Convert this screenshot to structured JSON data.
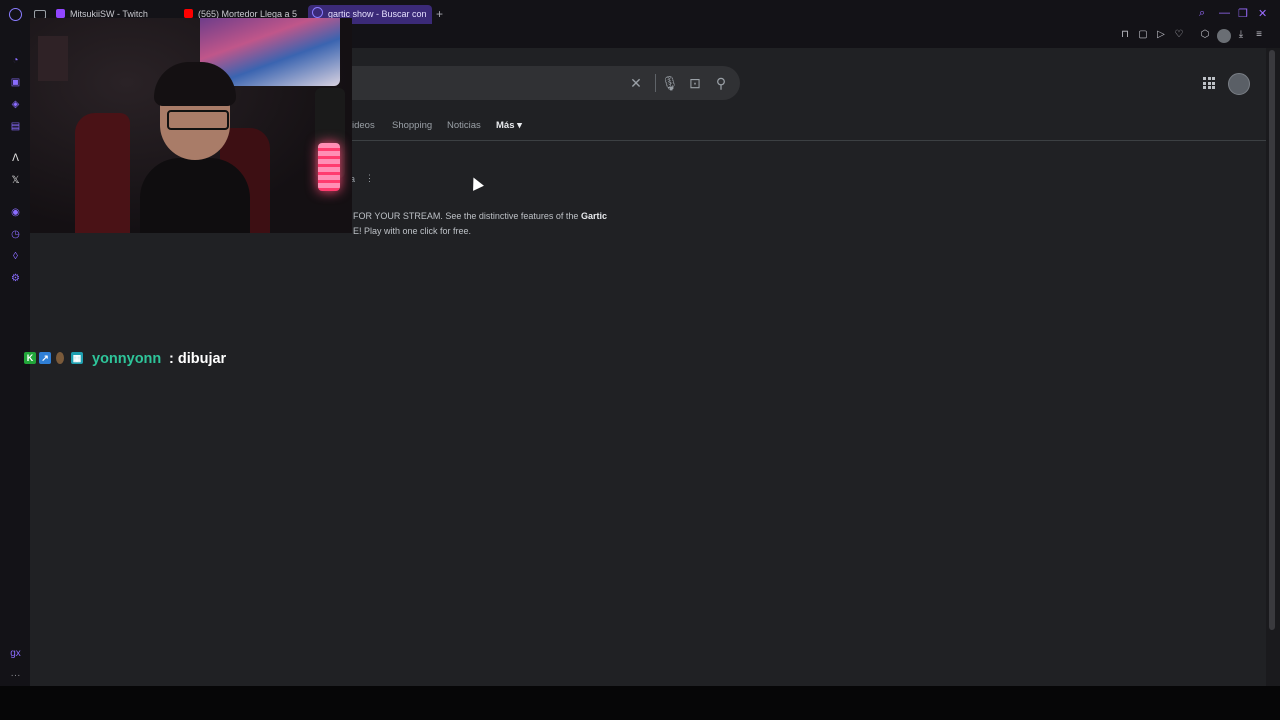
{
  "browser": {
    "tabs": [
      {
        "title": "MitsukiiSW - Twitch",
        "favicon": "twitch-icon",
        "color": "#9146ff"
      },
      {
        "title": "(565) Mortedor Llega a 5",
        "favicon": "youtube-icon",
        "color": "#ff0000"
      },
      {
        "title": "gartic show - Buscar con",
        "favicon": "google-icon",
        "color": "#8a7cff",
        "active": true
      }
    ],
    "new_tab": "+",
    "accent": "#8a6cff"
  },
  "search": {
    "query": "",
    "clear": "✕",
    "mic": "🎙",
    "lens": "⊡",
    "submit": "⚲"
  },
  "search_tabs": [
    {
      "label": "ideos"
    },
    {
      "label": "Shopping"
    },
    {
      "label": "Noticias"
    },
    {
      "label": "Más ▾",
      "active": true
    }
  ],
  "result": {
    "kebab": "⋮",
    "header_fragment": "a",
    "line1_pre": "FOR YOUR STREAM. See the distinctive features of the ",
    "line1_bold": "Gartic",
    "line2": "E! Play with one click for free."
  },
  "chat": {
    "username": "yonnyonn",
    "message": ": dibujar",
    "username_color": "#2ec59a"
  }
}
